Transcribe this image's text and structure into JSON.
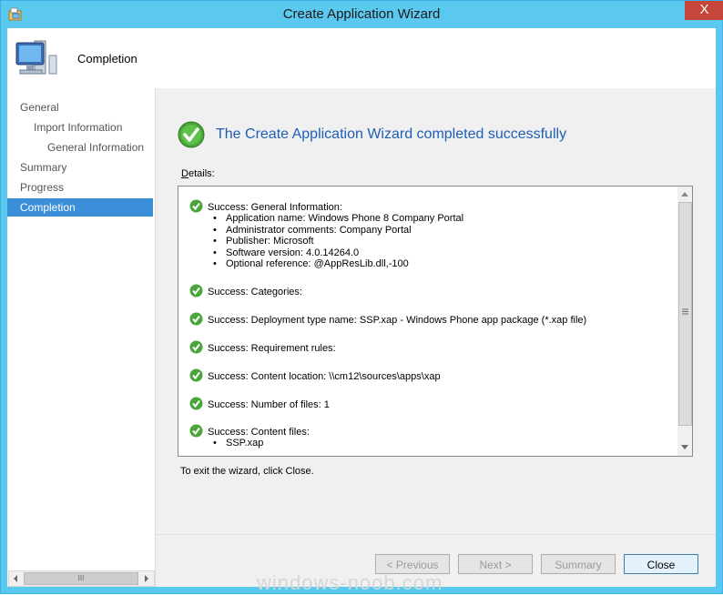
{
  "window": {
    "title": "Create Application Wizard",
    "close_label": "X"
  },
  "header": {
    "title": "Completion"
  },
  "nav": {
    "items": [
      {
        "label": "General"
      },
      {
        "label": "Import Information"
      },
      {
        "label": "General Information"
      },
      {
        "label": "Summary"
      },
      {
        "label": "Progress"
      },
      {
        "label": "Completion"
      }
    ],
    "scroll_thumb": "III"
  },
  "main": {
    "heading": "The Create Application Wizard completed successfully",
    "details_label_prefix": "D",
    "details_label_rest": "etails:",
    "exit_text": "To exit the wizard, click Close."
  },
  "details": {
    "entries": [
      {
        "text": "Success: General Information:",
        "bullets": [
          "Application name: Windows Phone 8 Company Portal",
          "Administrator comments: Company Portal",
          "Publisher: Microsoft",
          "Software version: 4.0.14264.0",
          "Optional reference: @AppResLib.dll,-100"
        ]
      },
      {
        "text": "Success: Categories:"
      },
      {
        "text": "Success: Deployment type name: SSP.xap - Windows Phone app package (*.xap file)"
      },
      {
        "text": "Success: Requirement rules:"
      },
      {
        "text": "Success: Content location: \\\\cm12\\sources\\apps\\xap"
      },
      {
        "text": "Success: Number of files: 1"
      },
      {
        "text": "Success: Content files:",
        "bullets": [
          "SSP.xap"
        ]
      }
    ]
  },
  "buttons": {
    "previous": "< Previous",
    "next": "Next >",
    "summary": "Summary",
    "close": "Close"
  },
  "watermark": "windows-noob.com",
  "colors": {
    "titlebar": "#5bc8ef",
    "accent": "#3b8fd8",
    "heading": "#1e5fb5",
    "success": "#3a9a2e"
  }
}
